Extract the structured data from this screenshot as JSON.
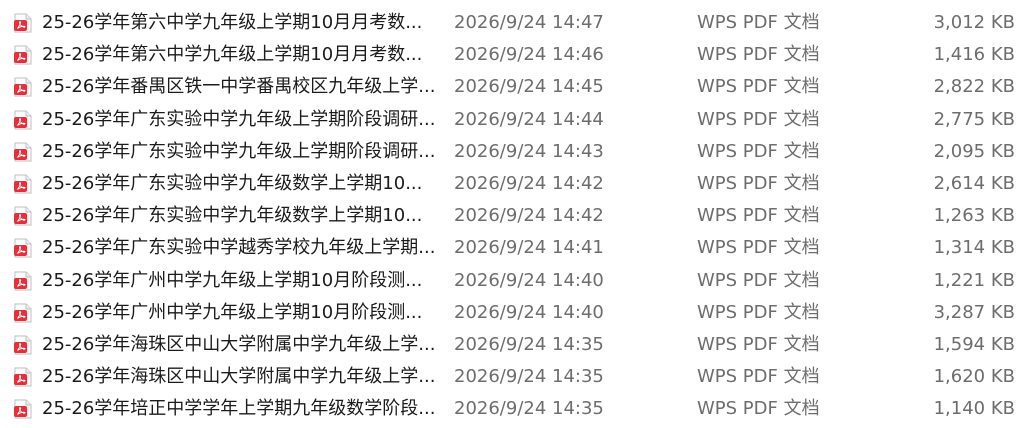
{
  "files": [
    {
      "name": "25-26学年第六中学九年级上学期10月月考数...",
      "modified": "2026/9/24 14:47",
      "type": "WPS PDF 文档",
      "size": "3,012 KB",
      "icon": "pdf-icon"
    },
    {
      "name": "25-26学年第六中学九年级上学期10月月考数...",
      "modified": "2026/9/24 14:46",
      "type": "WPS PDF 文档",
      "size": "1,416 KB",
      "icon": "pdf-icon"
    },
    {
      "name": "25-26学年番禺区铁一中学番禺校区九年级上学...",
      "modified": "2026/9/24 14:45",
      "type": "WPS PDF 文档",
      "size": "2,822 KB",
      "icon": "pdf-icon"
    },
    {
      "name": "25-26学年广东实验中学九年级上学期阶段调研...",
      "modified": "2026/9/24 14:44",
      "type": "WPS PDF 文档",
      "size": "2,775 KB",
      "icon": "pdf-icon"
    },
    {
      "name": "25-26学年广东实验中学九年级上学期阶段调研...",
      "modified": "2026/9/24 14:43",
      "type": "WPS PDF 文档",
      "size": "2,095 KB",
      "icon": "pdf-icon"
    },
    {
      "name": "25-26学年广东实验中学九年级数学上学期10...",
      "modified": "2026/9/24 14:42",
      "type": "WPS PDF 文档",
      "size": "2,614 KB",
      "icon": "pdf-icon"
    },
    {
      "name": "25-26学年广东实验中学九年级数学上学期10...",
      "modified": "2026/9/24 14:42",
      "type": "WPS PDF 文档",
      "size": "1,263 KB",
      "icon": "pdf-icon"
    },
    {
      "name": "25-26学年广东实验中学越秀学校九年级上学期...",
      "modified": "2026/9/24 14:41",
      "type": "WPS PDF 文档",
      "size": "1,314 KB",
      "icon": "pdf-icon"
    },
    {
      "name": "25-26学年广州中学九年级上学期10月阶段测...",
      "modified": "2026/9/24 14:40",
      "type": "WPS PDF 文档",
      "size": "1,221 KB",
      "icon": "pdf-icon"
    },
    {
      "name": "25-26学年广州中学九年级上学期10月阶段测...",
      "modified": "2026/9/24 14:40",
      "type": "WPS PDF 文档",
      "size": "3,287 KB",
      "icon": "pdf-icon"
    },
    {
      "name": "25-26学年海珠区中山大学附属中学九年级上学...",
      "modified": "2026/9/24 14:35",
      "type": "WPS PDF 文档",
      "size": "1,594 KB",
      "icon": "pdf-icon"
    },
    {
      "name": "25-26学年海珠区中山大学附属中学九年级上学...",
      "modified": "2026/9/24 14:35",
      "type": "WPS PDF 文档",
      "size": "1,620 KB",
      "icon": "pdf-icon"
    },
    {
      "name": "25-26学年培正中学学年上学期九年级数学阶段...",
      "modified": "2026/9/24 14:35",
      "type": "WPS PDF 文档",
      "size": "1,140 KB",
      "icon": "pdf-icon"
    }
  ],
  "colors": {
    "icon_red": "#e5303c",
    "text_primary": "#1b1b1b",
    "text_secondary": "#6d6d6d"
  }
}
